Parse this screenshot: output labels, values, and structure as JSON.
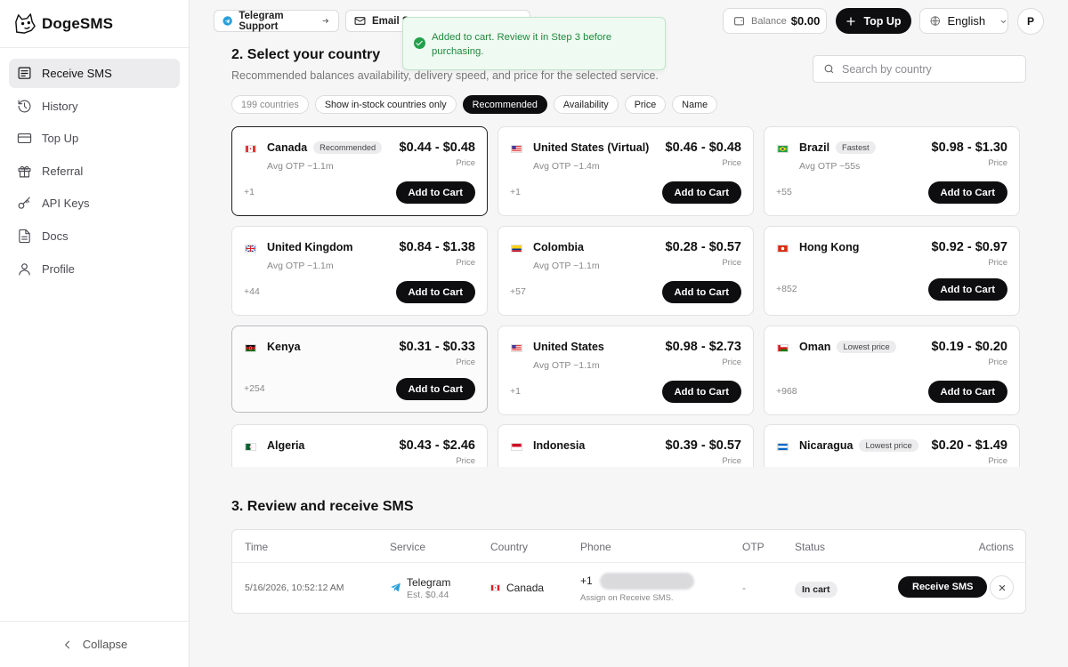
{
  "brand": {
    "name": "DogeSMS"
  },
  "sidebar": {
    "items": [
      {
        "label": "Receive SMS",
        "icon": "message-icon"
      },
      {
        "label": "History",
        "icon": "history-icon"
      },
      {
        "label": "Top Up",
        "icon": "card-icon"
      },
      {
        "label": "Referral",
        "icon": "gift-icon"
      },
      {
        "label": "API Keys",
        "icon": "key-icon"
      },
      {
        "label": "Docs",
        "icon": "doc-icon"
      },
      {
        "label": "Profile",
        "icon": "user-icon"
      }
    ],
    "collapse_label": "Collapse"
  },
  "topbar": {
    "telegram_label": "Telegram Support",
    "email_label": "Email S",
    "balance_label": "Balance",
    "balance_value": "$0.00",
    "topup_label": "Top Up",
    "language": "English",
    "avatar": "P"
  },
  "toast": {
    "message": "Added to cart. Review it in Step 3 before purchasing."
  },
  "section2": {
    "title": "2. Select your country",
    "subtitle": "Recommended balances availability, delivery speed, and price for the selected service.",
    "search_placeholder": "Search by country",
    "chips": [
      "199 countries",
      "Show in-stock countries only",
      "Recommended",
      "Availability",
      "Price",
      "Name"
    ]
  },
  "countries": [
    {
      "name": "Canada",
      "badge": "Recommended",
      "otp": "Avg OTP ~1.1m",
      "price": "$0.44 - $0.48",
      "price_label": "Price",
      "code": "+1",
      "add": "Add to Cart"
    },
    {
      "name": "United States (Virtual)",
      "badge": "",
      "otp": "Avg OTP ~1.4m",
      "price": "$0.46 - $0.48",
      "price_label": "Price",
      "code": "+1",
      "add": "Add to Cart"
    },
    {
      "name": "Brazil",
      "badge": "Fastest",
      "otp": "Avg OTP ~55s",
      "price": "$0.98 - $1.30",
      "price_label": "Price",
      "code": "+55",
      "add": "Add to Cart"
    },
    {
      "name": "United Kingdom",
      "badge": "",
      "otp": "Avg OTP ~1.1m",
      "price": "$0.84 - $1.38",
      "price_label": "Price",
      "code": "+44",
      "add": "Add to Cart"
    },
    {
      "name": "Colombia",
      "badge": "",
      "otp": "Avg OTP ~1.1m",
      "price": "$0.28 - $0.57",
      "price_label": "Price",
      "code": "+57",
      "add": "Add to Cart"
    },
    {
      "name": "Hong Kong",
      "badge": "",
      "otp": "",
      "price": "$0.92 - $0.97",
      "price_label": "Price",
      "code": "+852",
      "add": "Add to Cart"
    },
    {
      "name": "Kenya",
      "badge": "",
      "otp": "",
      "price": "$0.31 - $0.33",
      "price_label": "Price",
      "code": "+254",
      "add": "Add to Cart"
    },
    {
      "name": "United States",
      "badge": "",
      "otp": "Avg OTP ~1.1m",
      "price": "$0.98 - $2.73",
      "price_label": "Price",
      "code": "+1",
      "add": "Add to Cart"
    },
    {
      "name": "Oman",
      "badge": "Lowest price",
      "otp": "",
      "price": "$0.19 - $0.20",
      "price_label": "Price",
      "code": "+968",
      "add": "Add to Cart"
    },
    {
      "name": "Algeria",
      "badge": "",
      "otp": "",
      "price": "$0.43 - $2.46",
      "price_label": "Price",
      "code": "",
      "add": ""
    },
    {
      "name": "Indonesia",
      "badge": "",
      "otp": "",
      "price": "$0.39 - $0.57",
      "price_label": "Price",
      "code": "",
      "add": ""
    },
    {
      "name": "Nicaragua",
      "badge": "Lowest price",
      "otp": "",
      "price": "$0.20 - $1.49",
      "price_label": "Price",
      "code": "",
      "add": ""
    }
  ],
  "section3": {
    "title": "3. Review and receive SMS",
    "headers": [
      "Time",
      "Service",
      "Country",
      "Phone",
      "OTP",
      "Status",
      "Actions"
    ],
    "row": {
      "time": "5/16/2026, 10:52:12 AM",
      "service": "Telegram",
      "est": "Est. $0.44",
      "country": "Canada",
      "phone_prefix": "+1",
      "phone_note": "Assign on Receive SMS.",
      "otp": "-",
      "status": "In cart",
      "action": "Receive SMS"
    }
  },
  "colors": {
    "accent": "#0e0e10",
    "success": "#22a04a",
    "toast_bg": "#effaf2"
  }
}
